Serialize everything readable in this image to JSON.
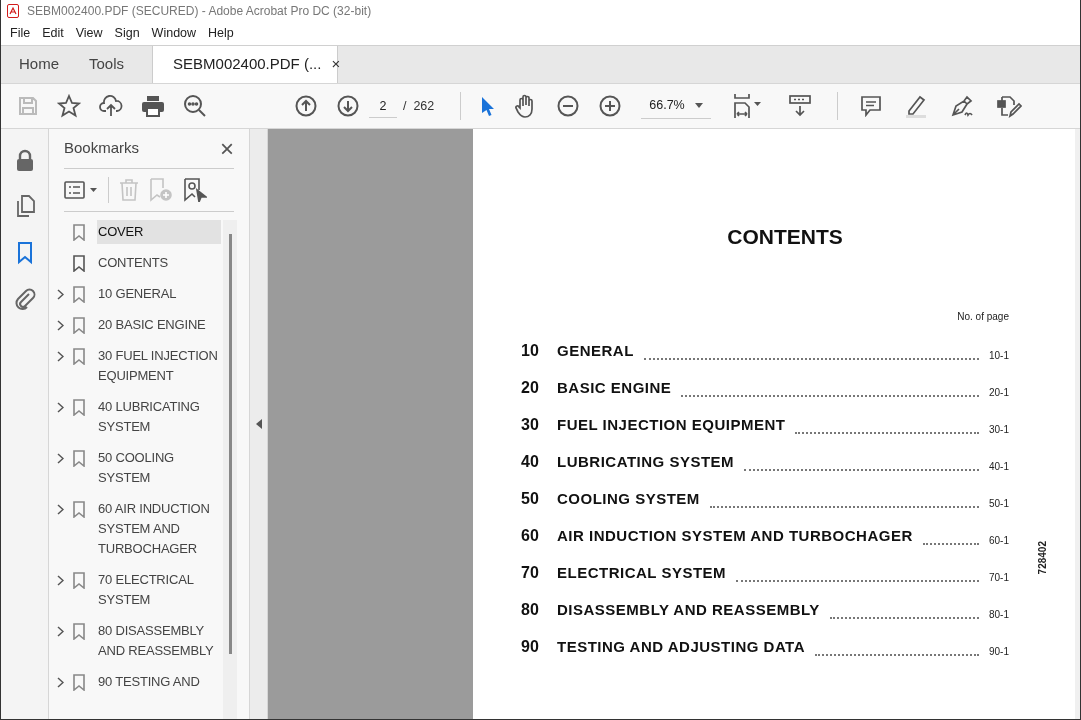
{
  "window": {
    "title": "SEBM002400.PDF (SECURED) - Adobe Acrobat Pro DC (32-bit)"
  },
  "menu": [
    "File",
    "Edit",
    "View",
    "Sign",
    "Window",
    "Help"
  ],
  "tabs": [
    {
      "label": "Home",
      "selected": false,
      "kind": "nav"
    },
    {
      "label": "Tools",
      "selected": false,
      "kind": "nav"
    },
    {
      "label": "SEBM002400.PDF (...",
      "selected": true,
      "kind": "document",
      "close": "×"
    }
  ],
  "toolbar": {
    "page_value": "2",
    "page_total": "/  262",
    "zoom": "66.7%"
  },
  "rail": [
    {
      "selected": false
    },
    {
      "selected": false
    },
    {
      "selected": true
    },
    {
      "selected": false
    }
  ],
  "bookmarks": {
    "title": "Bookmarks",
    "close": "×",
    "items": [
      {
        "label": "COVER",
        "kind": "leaf",
        "selected": true
      },
      {
        "label": "CONTENTS",
        "kind": "leaf",
        "selected": false
      },
      {
        "label": "10 GENERAL",
        "kind": "folder",
        "selected": false
      },
      {
        "label": "20 BASIC ENGINE",
        "kind": "folder",
        "selected": false
      },
      {
        "label": "30 FUEL INJECTION EQUIPMENT",
        "kind": "folder",
        "selected": false
      },
      {
        "label": "40 LUBRICATING SYSTEM",
        "kind": "folder",
        "selected": false
      },
      {
        "label": "50 COOLING SYSTEM",
        "kind": "folder",
        "selected": false
      },
      {
        "label": "60 AIR INDUCTION SYSTEM AND TURBOCHAGER",
        "kind": "folder",
        "selected": false
      },
      {
        "label": "70 ELECTRICAL SYSTEM",
        "kind": "folder",
        "selected": false
      },
      {
        "label": "80 DISASSEMBLY AND REASSEMBLY",
        "kind": "folder",
        "selected": false
      },
      {
        "label": "90 TESTING AND",
        "kind": "folder",
        "selected": false
      }
    ]
  },
  "document": {
    "heading": "CONTENTS",
    "column_label": "No. of page",
    "side_code": "728402",
    "entries": [
      {
        "number": "10",
        "title": "GENERAL",
        "page": "10-1"
      },
      {
        "number": "20",
        "title": "BASIC ENGINE",
        "page": "20-1"
      },
      {
        "number": "30",
        "title": "FUEL INJECTION EQUIPMENT",
        "page": "30-1"
      },
      {
        "number": "40",
        "title": "LUBRICATING SYSTEM",
        "page": "40-1"
      },
      {
        "number": "50",
        "title": "COOLING SYSTEM",
        "page": "50-1"
      },
      {
        "number": "60",
        "title": "AIR INDUCTION SYSTEM AND TURBOCHAGER",
        "page": "60-1"
      },
      {
        "number": "70",
        "title": "ELECTRICAL SYSTEM",
        "page": "70-1"
      },
      {
        "number": "80",
        "title": "DISASSEMBLY AND REASSEMBLY",
        "page": "80-1"
      },
      {
        "number": "90",
        "title": "TESTING AND ADJUSTING DATA",
        "page": "90-1"
      }
    ]
  }
}
